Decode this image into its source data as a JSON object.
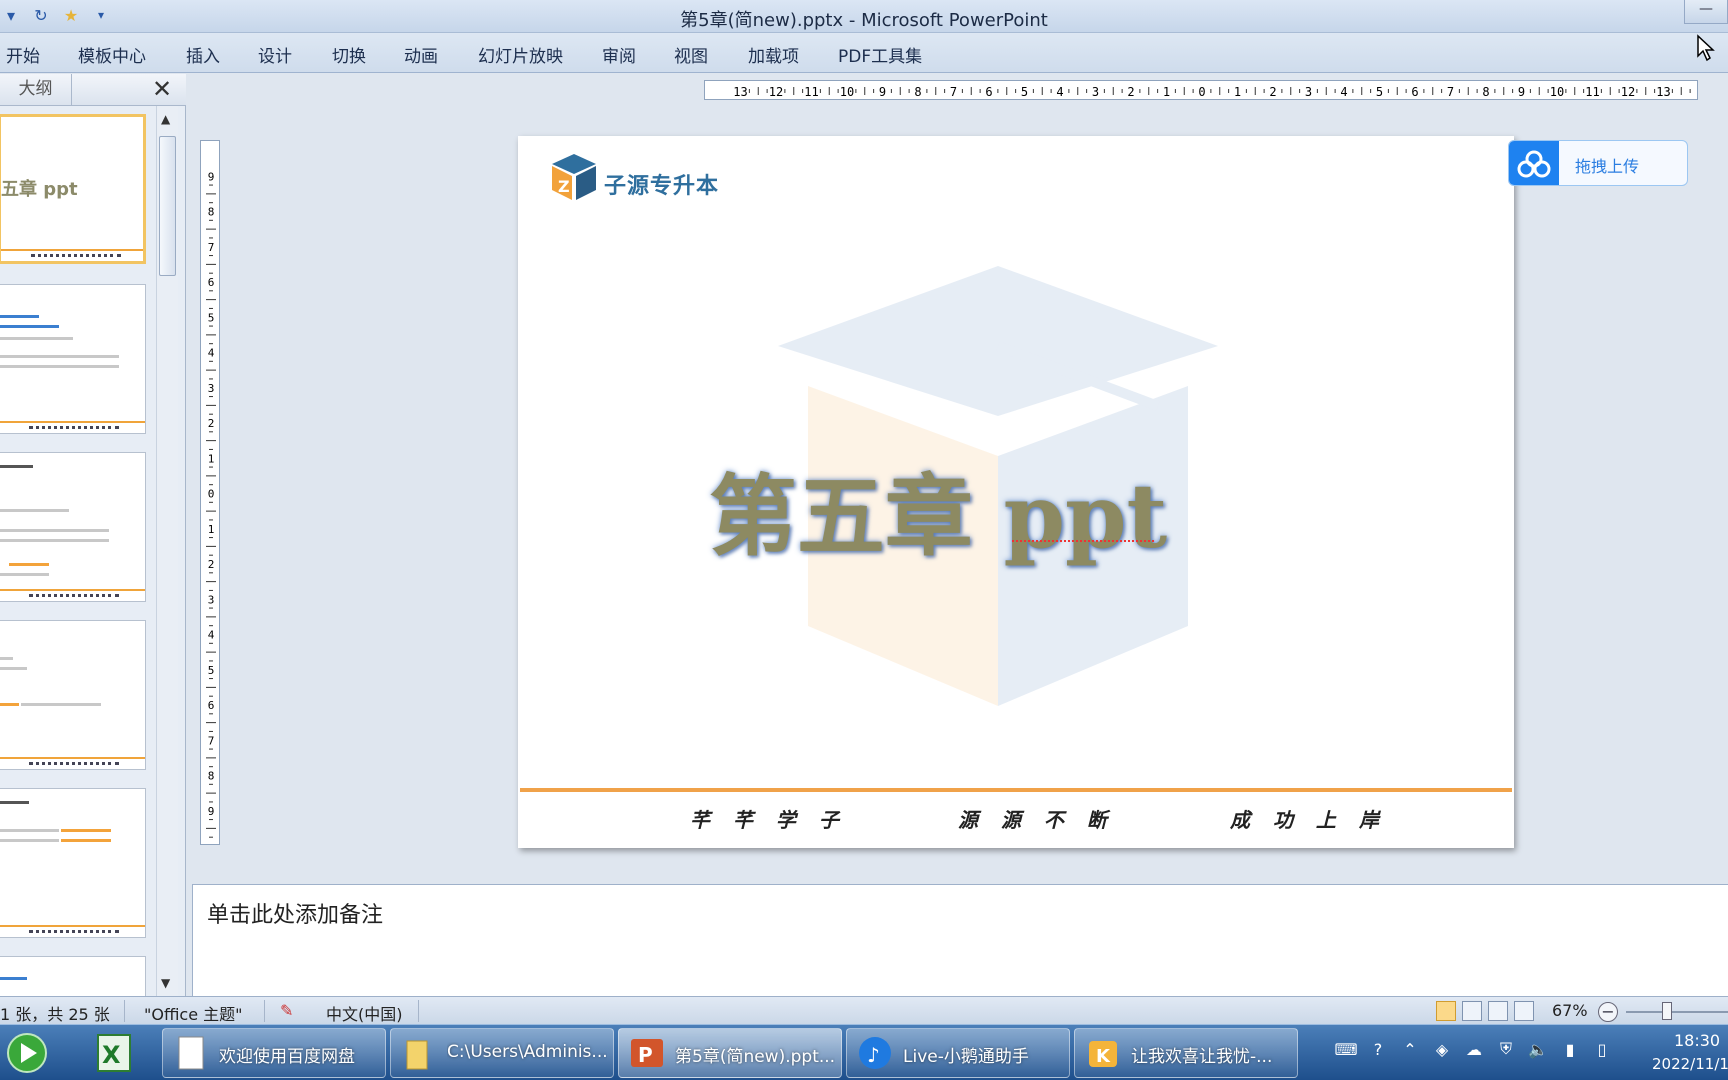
{
  "window": {
    "title": "第5章(简new).pptx  -  Microsoft PowerPoint",
    "minimize": "—"
  },
  "quick_access": {
    "undo_icon": "undo-icon",
    "redo_icon": "redo-icon",
    "star_icon": "star-icon",
    "customize_icon": "customize-icon"
  },
  "ribbon": {
    "tabs": [
      "开始",
      "模板中心",
      "插入",
      "设计",
      "切换",
      "动画",
      "幻灯片放映",
      "审阅",
      "视图",
      "加载项",
      "PDF工具集"
    ]
  },
  "left_panel": {
    "outline_tab": "大纲",
    "close": "✕",
    "thumb1_title": "五章  ppt"
  },
  "slide": {
    "logo_text": "子源专升本",
    "title": "第五章  ppt",
    "mottos": [
      "芊 芊 学 子",
      "源 源 不 断",
      "成 功 上 岸"
    ]
  },
  "upload_widget": {
    "label": "拖拽上传"
  },
  "notes": {
    "placeholder": "单击此处添加备注"
  },
  "status_bar": {
    "slide_count": "1 张，共 25 张",
    "theme": "\"Office 主题\"",
    "language": "中文(中国)",
    "zoom": "67%"
  },
  "taskbar": {
    "tasks": [
      {
        "label": "欢迎使用百度网盘"
      },
      {
        "label": "C:\\Users\\Adminis..."
      },
      {
        "label": "第5章(简new).ppt..."
      },
      {
        "label": "Live-小鹅通助手"
      },
      {
        "label": "让我欢喜让我忧-..."
      }
    ],
    "clock_time": "18:30",
    "clock_date": "2022/11/1"
  },
  "colors": {
    "accent_orange": "#f0a24a",
    "title_olive": "#8d8a62",
    "logo_blue": "#2f6f9e",
    "upload_blue": "#1e82f0"
  }
}
